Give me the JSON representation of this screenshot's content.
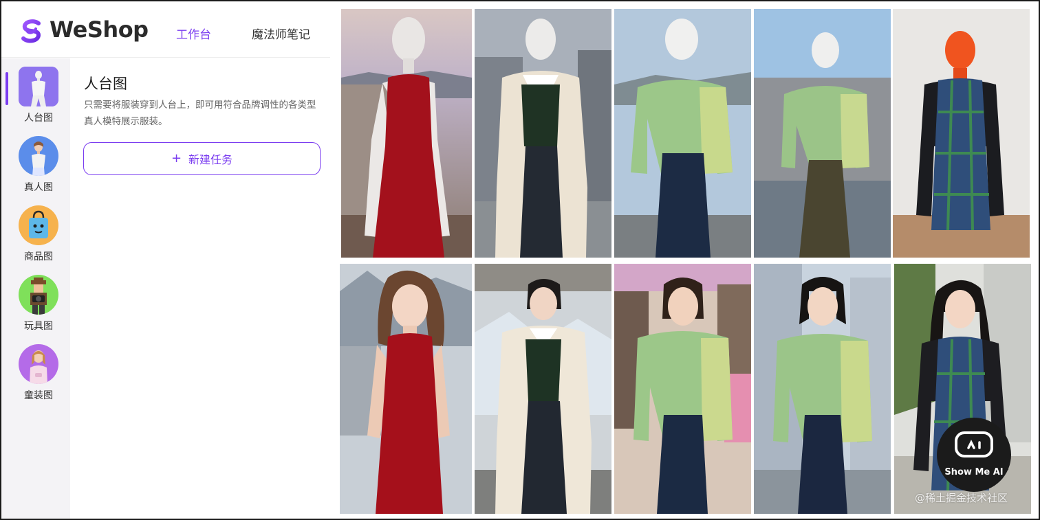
{
  "brand": {
    "name": "WeShop",
    "accent": "#7a3cf0"
  },
  "nav": {
    "tabs": [
      {
        "label": "工作台",
        "active": true
      },
      {
        "label": "魔法师笔记",
        "active": false
      }
    ]
  },
  "sidebar": {
    "items": [
      {
        "label": "人台图",
        "icon": "mannequin-icon",
        "active": true
      },
      {
        "label": "真人图",
        "icon": "model-person-icon",
        "active": false
      },
      {
        "label": "商品图",
        "icon": "product-bag-icon",
        "active": false
      },
      {
        "label": "玩具图",
        "icon": "toy-figure-icon",
        "active": false
      },
      {
        "label": "童装图",
        "icon": "kid-model-icon",
        "active": false
      }
    ]
  },
  "panel": {
    "title": "人台图",
    "description": "只需要将服装穿到人台上，即可用符合品牌调性的各类型真人模特展示服装。",
    "new_task_label": "新建任务",
    "new_task_icon": "plus-icon"
  },
  "gallery": {
    "rows": [
      {
        "type": "mannequin",
        "items": [
          "red-dress",
          "cream-coat-argyle-vest",
          "green-cardigan-denim-skirt",
          "green-cardigan-olive-skirt",
          "black-cardigan-plaid-dress"
        ]
      },
      {
        "type": "model",
        "items": [
          "red-dress",
          "cream-coat-argyle-vest",
          "green-cardigan-denim-skirt",
          "green-cardigan-denim-skirt",
          "black-cardigan-plaid-dress"
        ]
      }
    ]
  },
  "overlay": {
    "badge_label": "Show Me AI",
    "watermark": "@稀土掘金技术社区"
  }
}
